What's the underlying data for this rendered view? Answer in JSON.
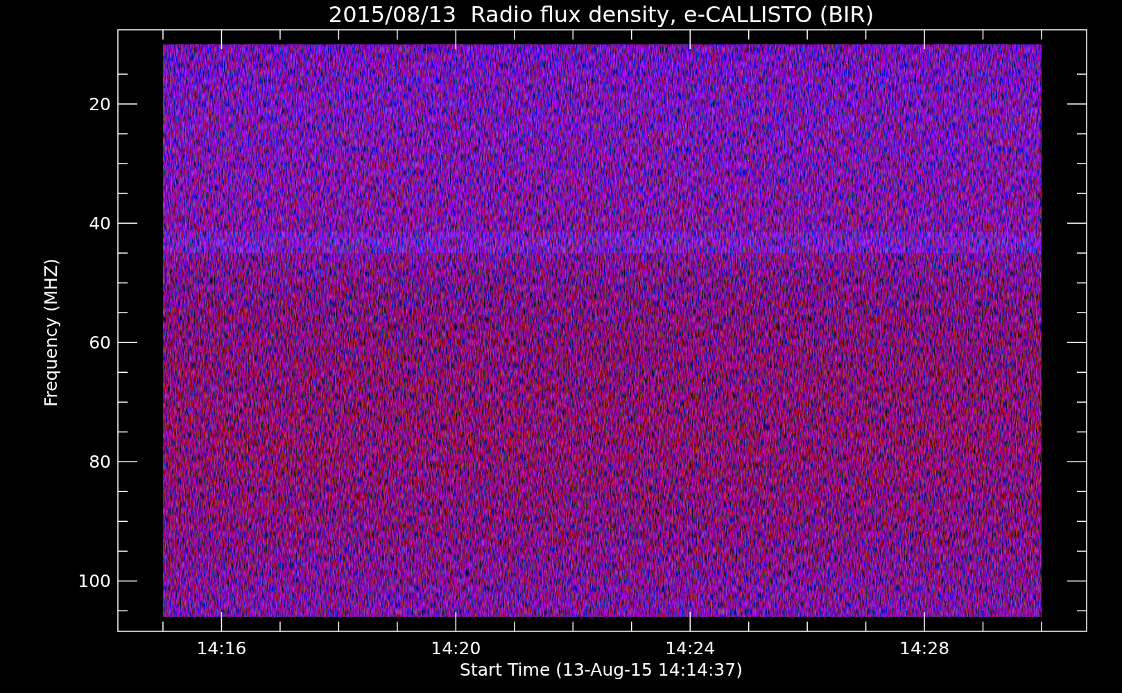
{
  "title": "2015/08/13  Radio flux density, e-CALLISTO (BIR)",
  "ylabel": "Frequency (MHZ)",
  "xlabel": "Start Time (13-Aug-15 14:14:37)",
  "yticks": [
    "20",
    "40",
    "60",
    "80",
    "100"
  ],
  "xticks": [
    "14:16",
    "14:20",
    "14:24",
    "14:28"
  ]
}
